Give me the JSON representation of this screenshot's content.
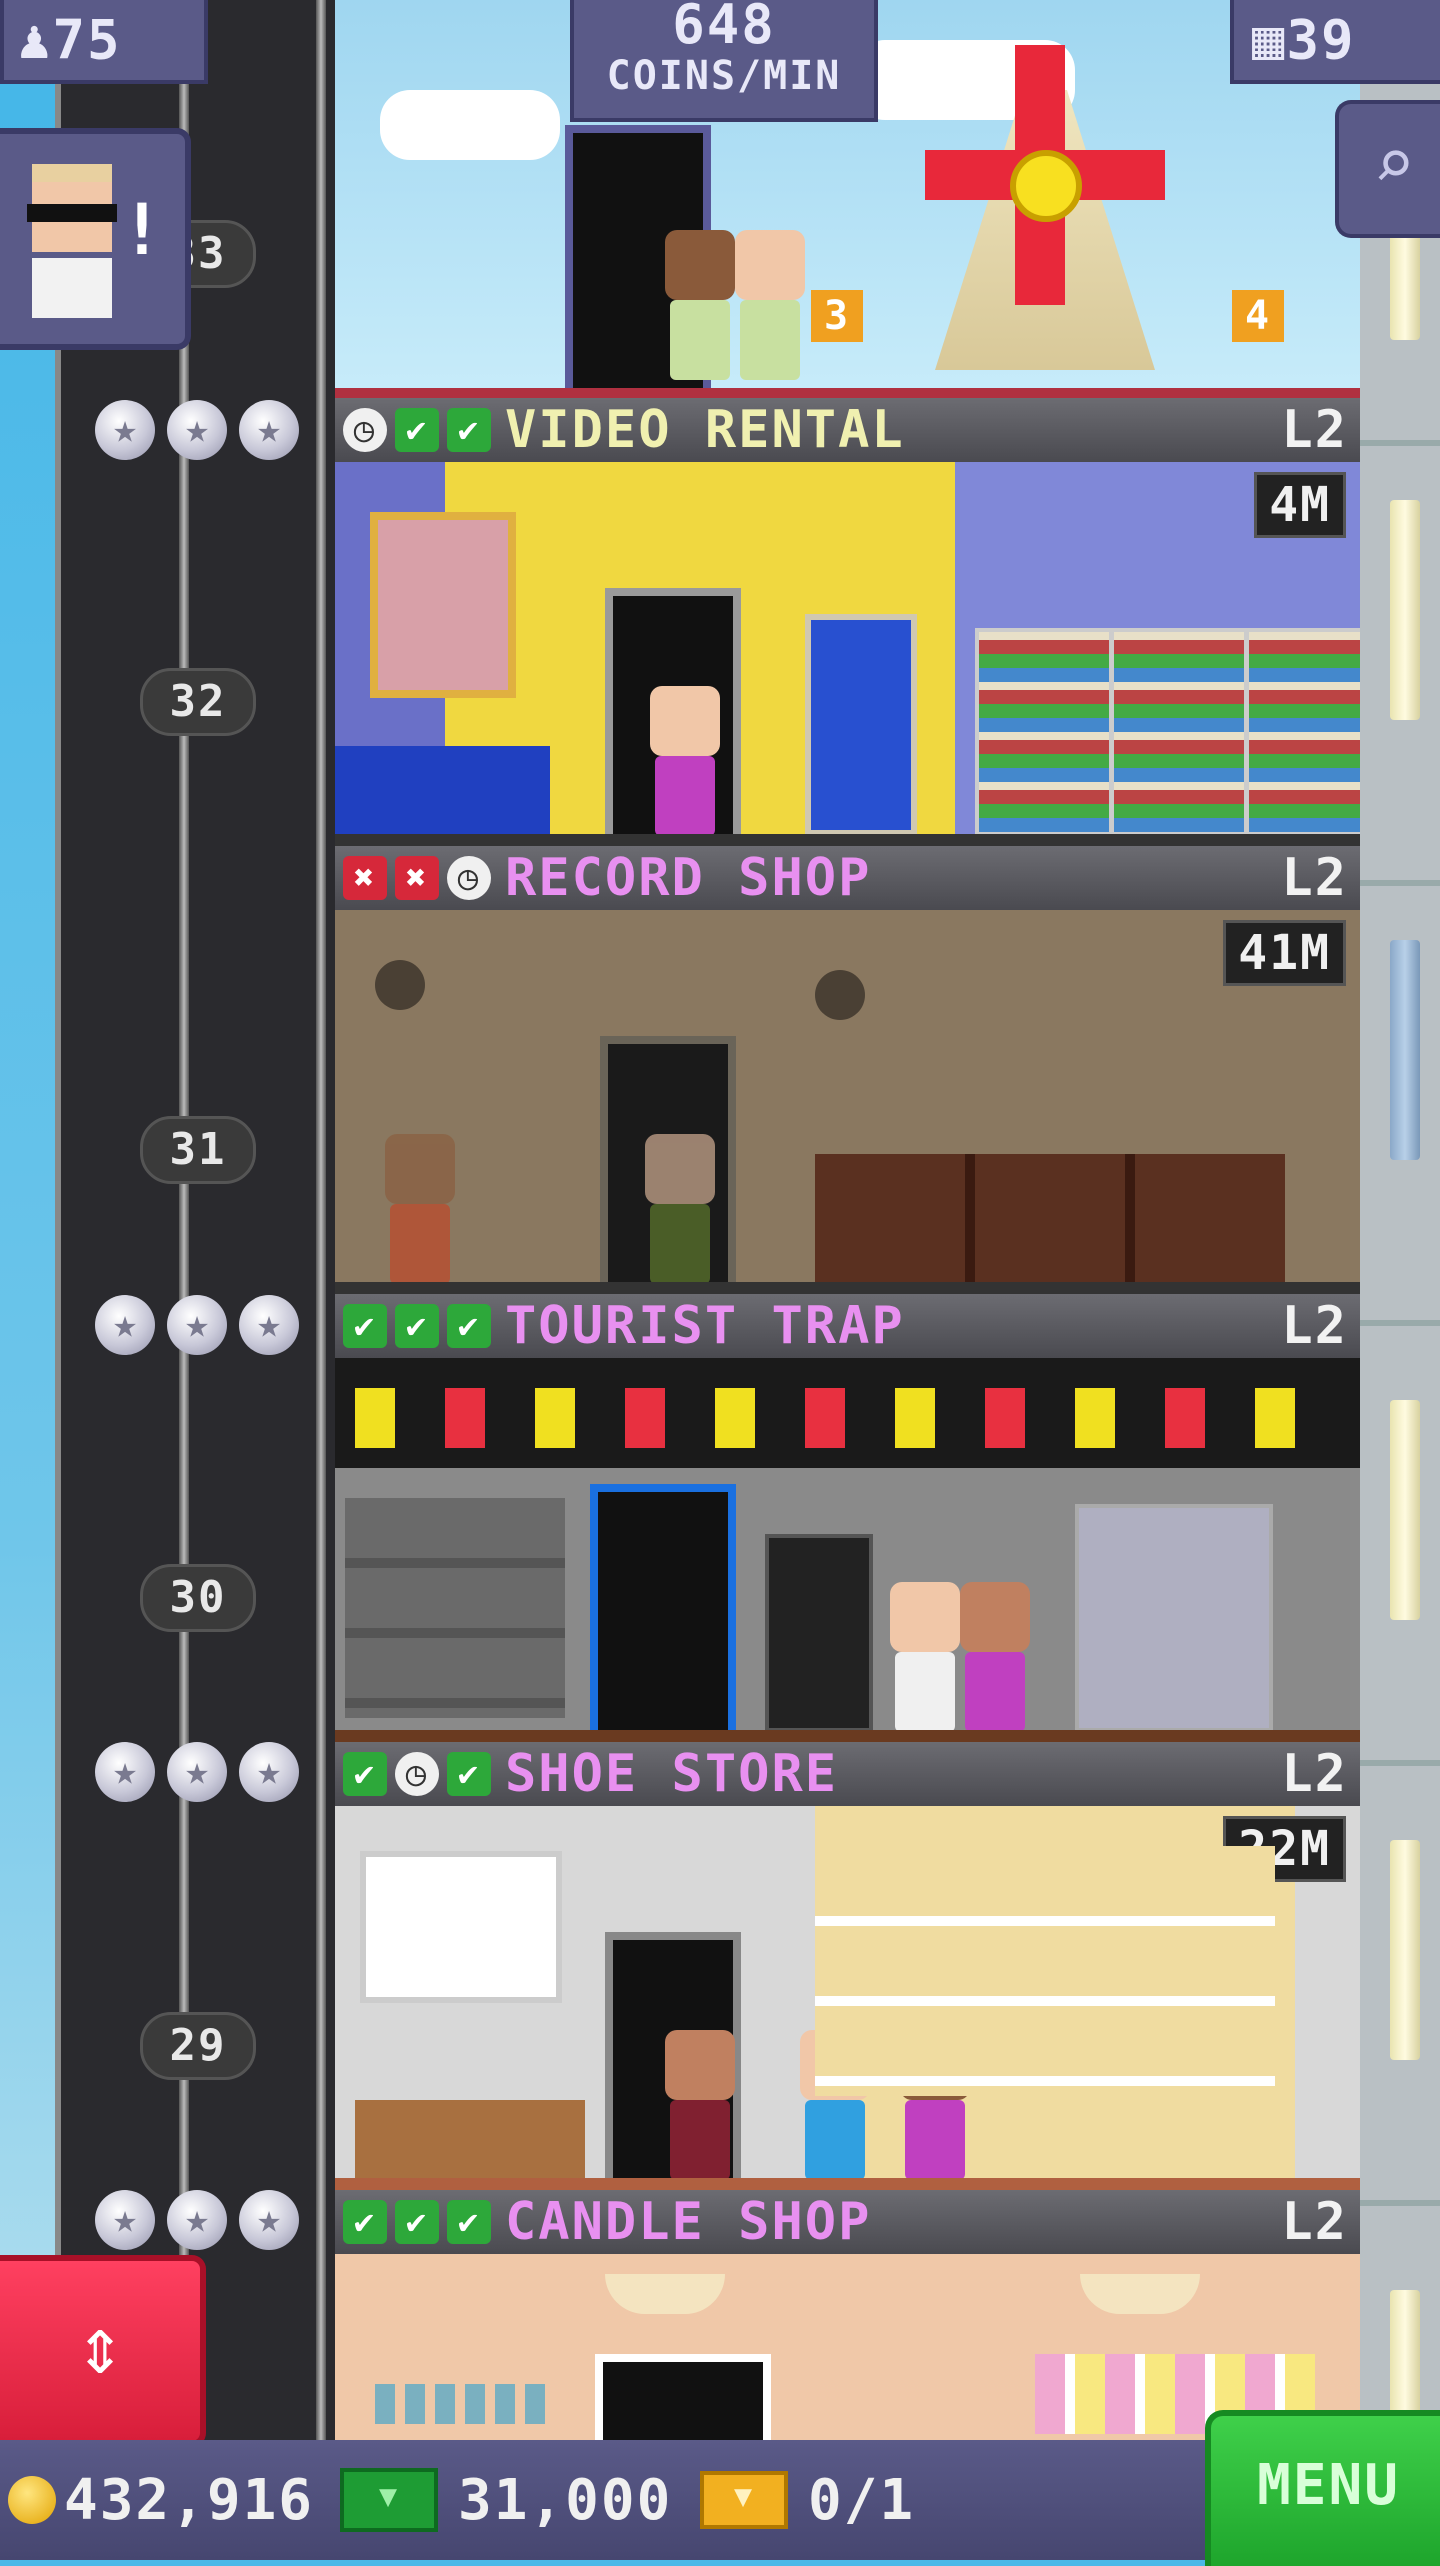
{
  "hud": {
    "population": "75",
    "coins_per_min_value": "648",
    "coins_per_min_unit": "COINS/MIN",
    "floor_count": "39"
  },
  "elevator": {
    "floor_labels": [
      "33",
      "32",
      "31",
      "30",
      "29"
    ]
  },
  "floors": [
    {
      "name": "VIDEO RENTAL",
      "level": "L2",
      "status": [
        "wait",
        "ok",
        "ok"
      ],
      "stock": "4M"
    },
    {
      "name": "RECORD SHOP",
      "level": "L2",
      "status": [
        "no",
        "no",
        "wait"
      ],
      "stock": "41M"
    },
    {
      "name": "TOURIST TRAP",
      "level": "L2",
      "status": [
        "ok",
        "ok",
        "ok"
      ],
      "stock": ""
    },
    {
      "name": "SHOE STORE",
      "level": "L2",
      "status": [
        "ok",
        "wait",
        "ok"
      ],
      "stock": "22M"
    },
    {
      "name": "CANDLE SHOP",
      "level": "L2",
      "status": [
        "ok",
        "ok",
        "ok"
      ],
      "stock": ""
    }
  ],
  "lobby_floor": {
    "room_numbers": [
      "3",
      "4"
    ]
  },
  "bottom": {
    "coins": "432,916",
    "bux": "31,000",
    "tickets": "0/1",
    "menu_label": "MENU"
  },
  "icons": {
    "status_ok": "✔",
    "status_no": "✖",
    "status_wait": "◷",
    "search": "search-icon",
    "elevator": "elevator-arrows-icon"
  },
  "colors": {
    "floor_name": "#e890f0",
    "hud_panel": "#5a5a88",
    "menu_button": "#2dbd3a",
    "elevator_button": "#e8263f"
  }
}
